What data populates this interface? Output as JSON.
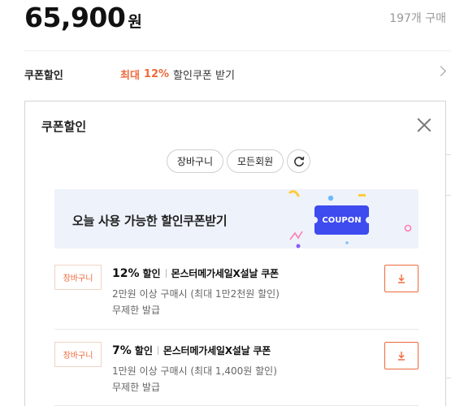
{
  "product": {
    "price": "65,900",
    "price_unit": "원",
    "purchase_count": "197개 구매"
  },
  "coupon_row": {
    "label": "쿠폰할인",
    "max_label": "최대",
    "max_value": "12%",
    "text": "할인쿠폰 받기"
  },
  "popup": {
    "title": "쿠폰할인",
    "filters": [
      "장바구니",
      "모든회원"
    ],
    "banner": {
      "text": "오늘 사용 가능한 할인쿠폰받기",
      "ticket_label": "COUPON"
    },
    "coupons": [
      {
        "badge": "장바구니",
        "percent": "12%",
        "percent_suffix": "할인",
        "name": "몬스터메가세일X설날 쿠폰",
        "condition": "2만원 이상 구매시 (최대 1만2천원 할인)",
        "limit": "무제한 발급"
      },
      {
        "badge": "장바구니",
        "percent": "7%",
        "percent_suffix": "할인",
        "name": "몬스터메가세일X설날 쿠폰",
        "condition": "1만원 이상 구매시 (최대 1,400원 할인)",
        "limit": "무제한 발급"
      }
    ]
  },
  "colors": {
    "accent": "#ee6a3b",
    "banner_bg": "#eef2fb",
    "ticket": "#3d4bef"
  },
  "icons": [
    "close-icon",
    "refresh-icon",
    "download-icon",
    "chevron-right-icon"
  ]
}
